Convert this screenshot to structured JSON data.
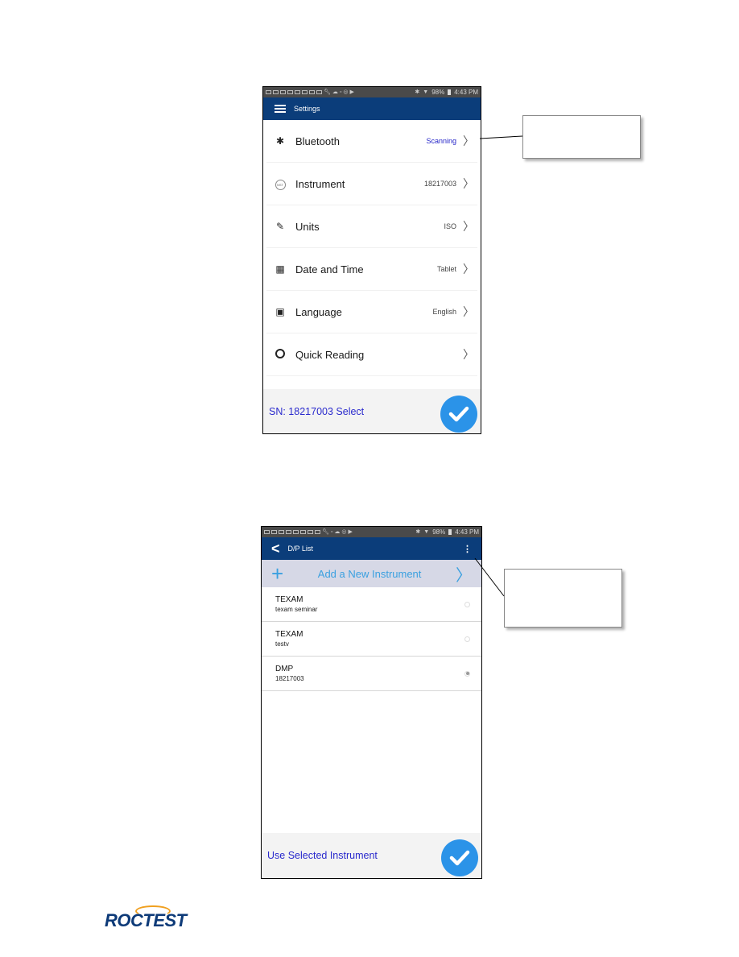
{
  "screen1": {
    "status_bar": {
      "battery": "98%",
      "time": "4:43 PM"
    },
    "title": "Settings",
    "items": [
      {
        "label": "Bluetooth",
        "value": "Scanning",
        "icon": "bluetooth-icon"
      },
      {
        "label": "Instrument",
        "value": "18217003",
        "icon": "instrument-icon"
      },
      {
        "label": "Units",
        "value": "ISO",
        "icon": "ruler-icon"
      },
      {
        "label": "Date and Time",
        "value": "Tablet",
        "icon": "calendar-icon"
      },
      {
        "label": "Language",
        "value": "English",
        "icon": "translate-icon"
      },
      {
        "label": "Quick Reading",
        "value": "",
        "icon": "gauge-icon"
      }
    ],
    "bottom_label": "SN: 18217003 Select"
  },
  "screen2": {
    "status_bar": {
      "battery": "98%",
      "time": "4:43 PM"
    },
    "title": "D/P List",
    "add_label": "Add a New Instrument",
    "instruments": [
      {
        "name": "TEXAM",
        "sub": "texam seminar",
        "selected": false
      },
      {
        "name": "TEXAM",
        "sub": "testv",
        "selected": false
      },
      {
        "name": "DMP",
        "sub": "18217003",
        "selected": true
      }
    ],
    "bottom_label": "Use Selected Instrument"
  },
  "logo": {
    "text": "ROCTEST"
  },
  "colors": {
    "appbar": "#0b3d7a",
    "accent": "#2b93e8",
    "link": "#2a2acd",
    "add_row": "#d6d8e6"
  }
}
